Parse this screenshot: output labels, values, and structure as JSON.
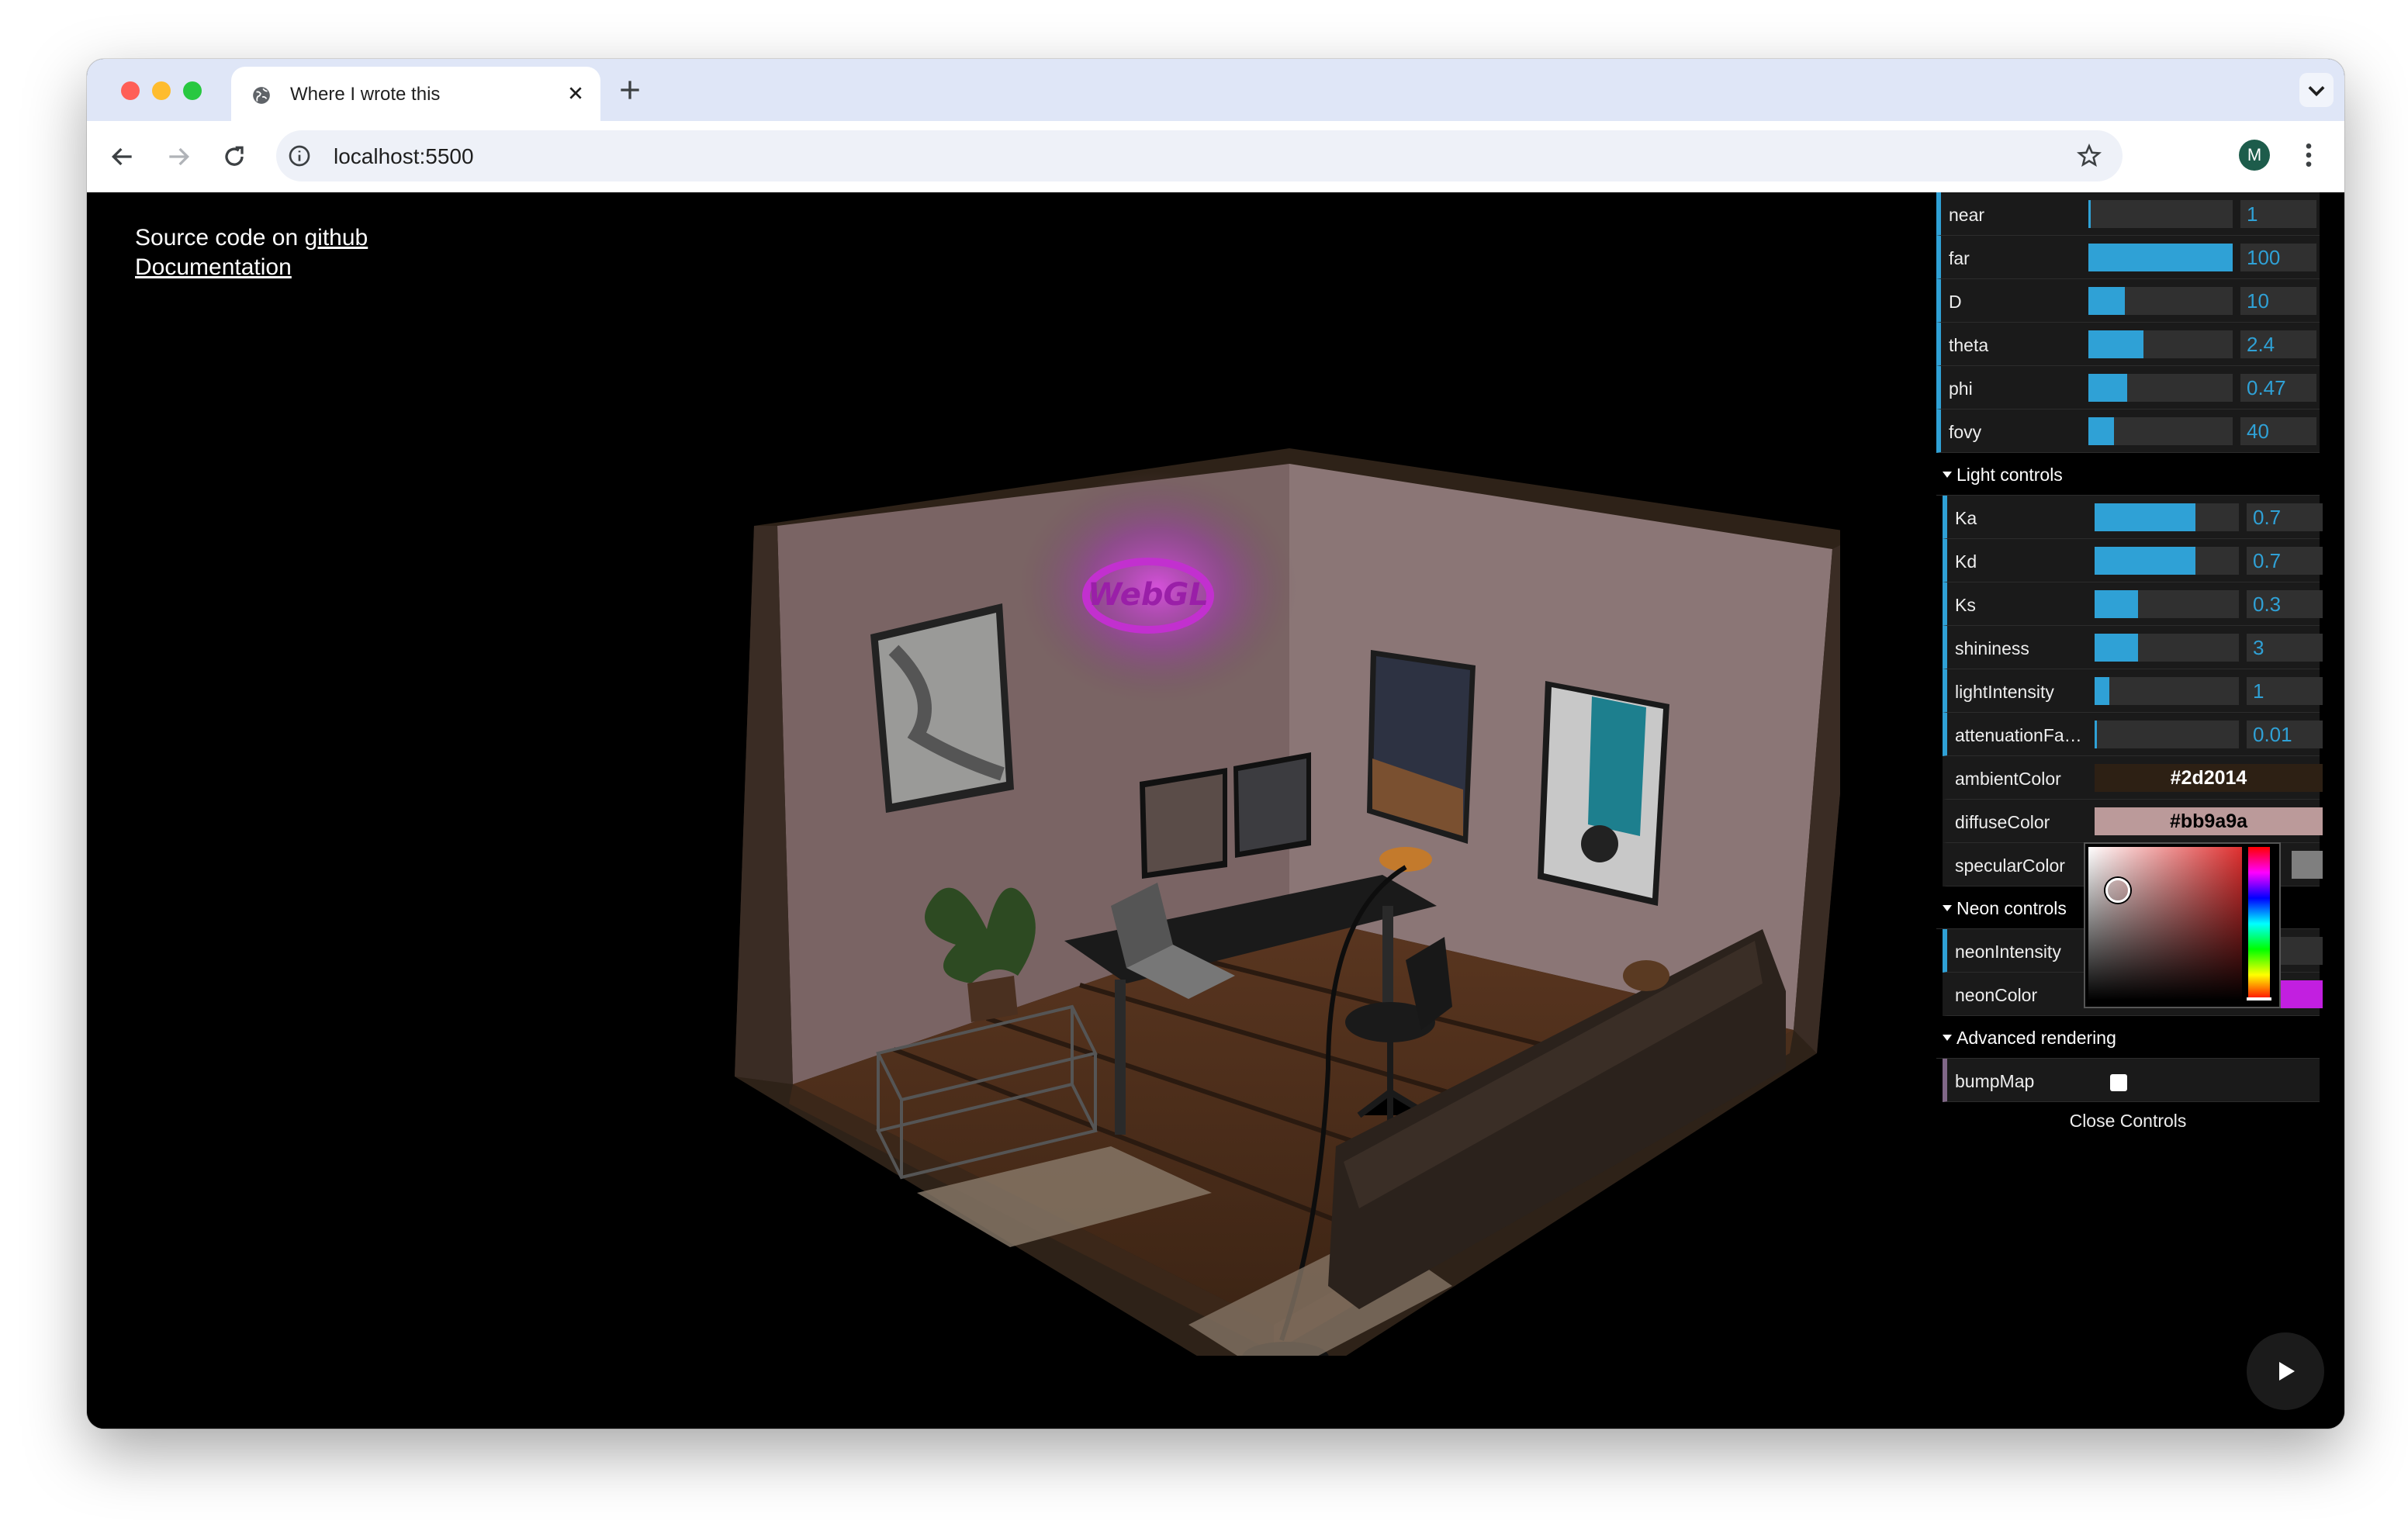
{
  "browser": {
    "tab_title": "Where I wrote this",
    "url": "localhost:5500",
    "avatar_letter": "M"
  },
  "page": {
    "source_prefix": "Source code on ",
    "github_link": "github",
    "documentation_link": "Documentation"
  },
  "gui": {
    "camera_sliders": [
      {
        "label": "near",
        "value": "1",
        "fill": 0.0
      },
      {
        "label": "far",
        "value": "100",
        "fill": 1.0
      },
      {
        "label": "D",
        "value": "10",
        "fill": 0.25
      },
      {
        "label": "theta",
        "value": "2.4",
        "fill": 0.38
      },
      {
        "label": "phi",
        "value": "0.47",
        "fill": 0.27
      },
      {
        "label": "fovy",
        "value": "40",
        "fill": 0.18
      }
    ],
    "light_folder": "Light controls",
    "light_sliders": [
      {
        "label": "Ka",
        "value": "0.7",
        "fill": 0.7
      },
      {
        "label": "Kd",
        "value": "0.7",
        "fill": 0.7
      },
      {
        "label": "Ks",
        "value": "0.3",
        "fill": 0.3
      },
      {
        "label": "shininess",
        "value": "3",
        "fill": 0.3
      },
      {
        "label": "lightIntensity",
        "value": "1",
        "fill": 0.1
      },
      {
        "label": "attenuationFac...",
        "value": "0.01",
        "fill": 0.01
      }
    ],
    "colors": [
      {
        "label": "ambientColor",
        "value": "#2d2014",
        "bg": "#2d2014",
        "fg": "#ffffff"
      },
      {
        "label": "diffuseColor",
        "value": "#bb9a9a",
        "bg": "#bb9a9a",
        "fg": "#000000"
      },
      {
        "label": "specularColor",
        "value": "",
        "bg": "#7f7f7f",
        "fg": "#000000"
      }
    ],
    "neon_folder": "Neon controls",
    "neon_intensity_label": "neonIntensity",
    "neon_color_label": "neonColor",
    "neon_color": "#c21fe0",
    "advanced_folder": "Advanced rendering",
    "bump_map_label": "bumpMap",
    "close_label": "Close Controls"
  },
  "scene": {
    "sign_text": "WebGL"
  }
}
